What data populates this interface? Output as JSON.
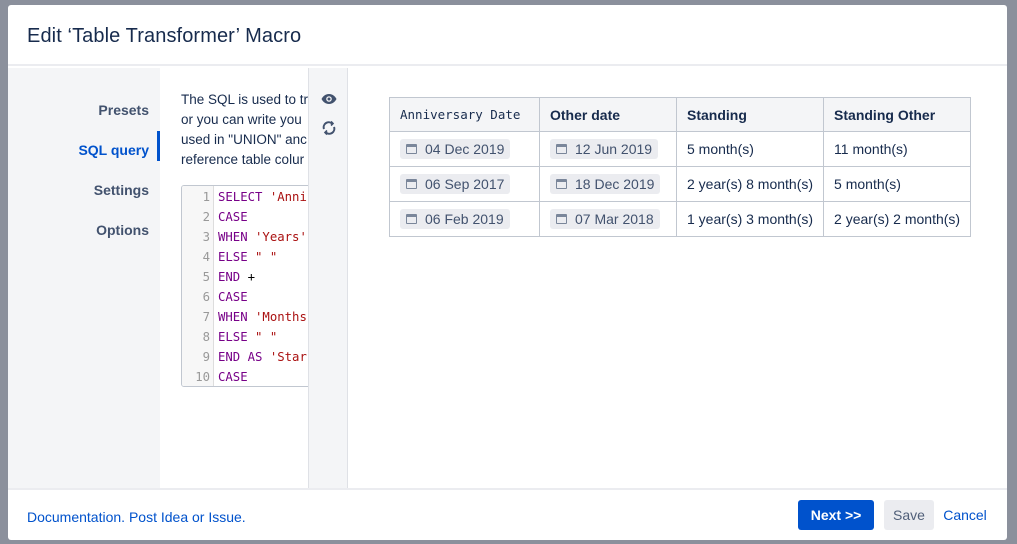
{
  "dialog": {
    "title": "Edit ‘Table Transformer’ Macro"
  },
  "nav": {
    "items": [
      {
        "label": "Presets"
      },
      {
        "label": "SQL query",
        "active": true
      },
      {
        "label": "Settings"
      },
      {
        "label": "Options"
      }
    ]
  },
  "description": {
    "lines": [
      "The SQL is used to tr",
      "or you can write you",
      "used in \"UNION\" anc",
      "reference table colur"
    ]
  },
  "editor": {
    "lines": [
      {
        "n": "1",
        "kw": "SELECT ",
        "str": "'Anni",
        "op": ""
      },
      {
        "n": "2",
        "kw": "CASE",
        "str": "",
        "op": ""
      },
      {
        "n": "3",
        "kw": "WHEN ",
        "str": "'Years'",
        "op": ""
      },
      {
        "n": "4",
        "kw": "ELSE ",
        "str": "\" \"",
        "op": ""
      },
      {
        "n": "5",
        "kw": "END ",
        "str": "",
        "op": "+"
      },
      {
        "n": "6",
        "kw": "CASE",
        "str": "",
        "op": ""
      },
      {
        "n": "7",
        "kw": "WHEN ",
        "str": "'Months",
        "op": ""
      },
      {
        "n": "8",
        "kw": "ELSE ",
        "str": "\" \"",
        "op": ""
      },
      {
        "n": "9",
        "kw": "END AS ",
        "str": "'Star",
        "op": ""
      },
      {
        "n": "10",
        "kw": "CASE",
        "str": "",
        "op": ""
      }
    ]
  },
  "tools": {
    "preview_icon": "eye-icon",
    "refresh_icon": "refresh-icon"
  },
  "table": {
    "headers": [
      "Anniversary Date",
      "Other date",
      "Standing",
      "Standing Other"
    ],
    "rows": [
      [
        "04 Dec 2019",
        "12 Jun 2019",
        "5 month(s)",
        "11 month(s)"
      ],
      [
        "06 Sep 2017",
        "18 Dec 2019",
        "2 year(s) 8 month(s)",
        "5 month(s)"
      ],
      [
        "06 Feb 2019",
        "07 Mar 2018",
        "1 year(s) 3 month(s)",
        "2 year(s) 2 month(s)"
      ]
    ]
  },
  "footer": {
    "documentation": "Documentation.",
    "post_idea": "Post Idea or Issue.",
    "next": "Next >>",
    "save": "Save",
    "cancel": "Cancel"
  },
  "colors": {
    "accent": "#0052cc",
    "overlay": "#8b909c"
  }
}
